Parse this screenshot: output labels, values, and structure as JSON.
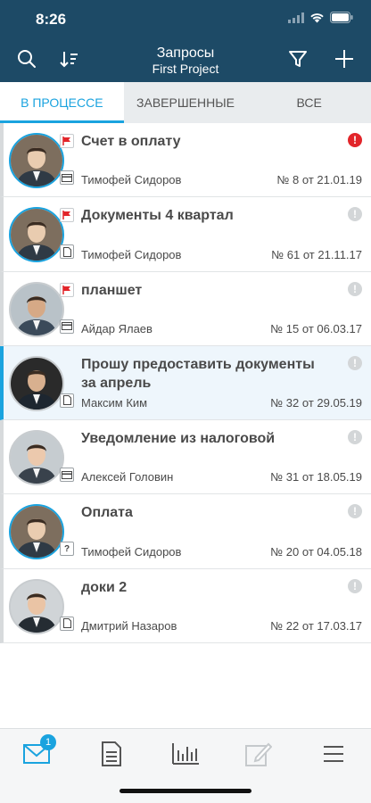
{
  "status": {
    "time": "8:26"
  },
  "header": {
    "title": "Запросы",
    "subtitle": "First Project"
  },
  "tabs": [
    {
      "label": "В процессе",
      "active": true
    },
    {
      "label": "Завершенные",
      "active": false
    },
    {
      "label": "Все",
      "active": false
    }
  ],
  "requests": [
    {
      "subject": "Счет в оплату",
      "author": "Тимофей Сидоров",
      "number": "№ 8 от 21.01.19",
      "flag": true,
      "type_icon": "card-icon",
      "status": "urgent",
      "online": true
    },
    {
      "subject": "Документы 4 квартал",
      "author": "Тимофей Сидоров",
      "number": "№ 61 от 21.11.17",
      "flag": true,
      "type_icon": "document-icon",
      "status": "normal",
      "online": true
    },
    {
      "subject": "планшет",
      "author": "Айдар Ялаев",
      "number": "№ 15 от 06.03.17",
      "flag": true,
      "type_icon": "card-icon",
      "status": "normal",
      "online": false
    },
    {
      "subject": "Прошу предоставить документы за апрель",
      "author": "Максим Ким",
      "number": "№ 32 от 29.05.19",
      "flag": false,
      "type_icon": "document-icon",
      "status": "normal",
      "online": false,
      "selected": true
    },
    {
      "subject": "Уведомление из налоговой",
      "author": "Алексей Головин",
      "number": "№ 31 от 18.05.19",
      "flag": false,
      "type_icon": "card-icon",
      "status": "normal",
      "online": false
    },
    {
      "subject": "Оплата",
      "author": "Тимофей Сидоров",
      "number": "№ 20 от 04.05.18",
      "flag": false,
      "type_icon": "question-icon",
      "status": "normal",
      "online": true
    },
    {
      "subject": "доки 2",
      "author": "Дмитрий Назаров",
      "number": "№ 22 от 17.03.17",
      "flag": false,
      "type_icon": "document-icon",
      "status": "normal",
      "online": false
    }
  ],
  "status_symbol": "!",
  "question_symbol": "?",
  "bottom_nav": {
    "inbox_badge": "1",
    "items": [
      "mail-icon",
      "document-icon",
      "chart-icon",
      "edit-icon",
      "menu-icon"
    ]
  },
  "colors": {
    "header": "#1d4a66",
    "accent": "#1aa3df",
    "urgent": "#e2252a",
    "flag": "#e2252a"
  }
}
